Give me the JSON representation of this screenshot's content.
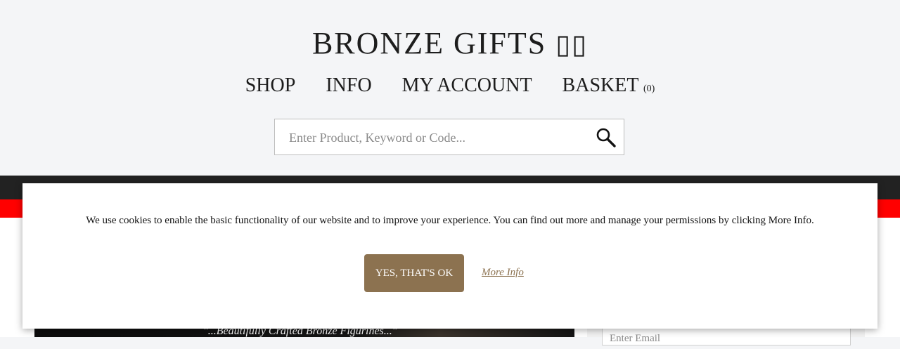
{
  "brand": {
    "title": "BRONZE GIFTS",
    "glyph": "▯▯"
  },
  "nav": {
    "items": [
      {
        "label": "SHOP"
      },
      {
        "label": "INFO"
      },
      {
        "label": "MY ACCOUNT"
      },
      {
        "label": "BASKET"
      }
    ],
    "basket_count": "(0)"
  },
  "search": {
    "placeholder": "Enter Product, Keyword or Code..."
  },
  "hero": {
    "tagline": "\"...Beautifully Crafted Bronze Figurines...\""
  },
  "newsletter": {
    "email_placeholder": "Enter Email"
  },
  "cookie": {
    "message": "We use cookies to enable the basic functionality of our website and to improve your experience. You can find out more and manage your permissions by clicking More Info.",
    "accept_label": "YES, THAT'S OK",
    "more_label": "More Info"
  },
  "colors": {
    "accent": "#8c7250",
    "red_bar": "#ff0000",
    "dark_bar": "#222222"
  }
}
